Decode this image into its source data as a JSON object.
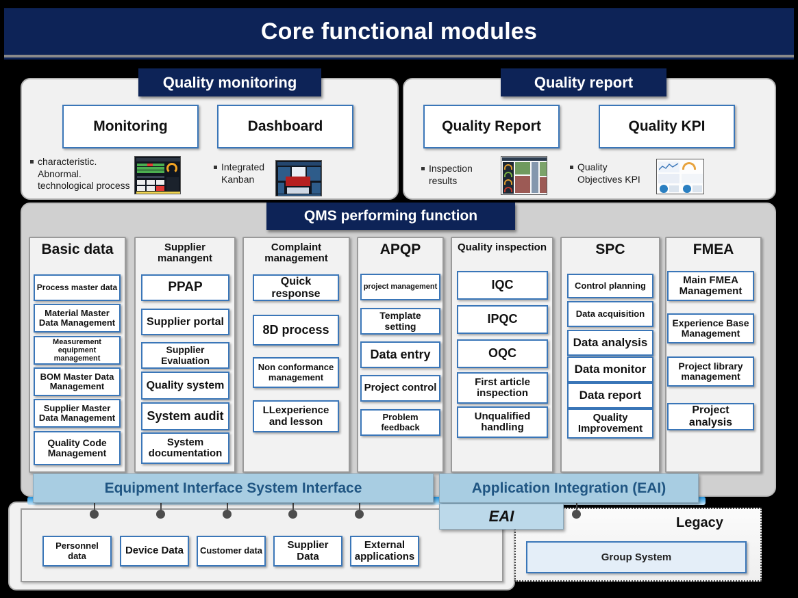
{
  "header": {
    "title": "Core functional modules"
  },
  "top_sections": [
    {
      "ribbon": "Quality monitoring",
      "boxes": [
        "Monitoring",
        "Dashboard"
      ],
      "bullets": [
        "characteristic.\nAbnormal.\ntechnological process",
        "Integrated\nKanban"
      ],
      "bullet_lines": [
        [
          "characteristic.",
          "Abnormal.",
          "technological process"
        ],
        [
          "Integrated",
          "Kanban"
        ]
      ],
      "thumbnails": [
        "monitoring-screenshot-thumbnail",
        "kanban-screenshot-thumbnail"
      ]
    },
    {
      "ribbon": "Quality report",
      "boxes": [
        "Quality Report",
        "Quality KPI"
      ],
      "bullet_lines": [
        [
          "Inspection",
          "results"
        ],
        [
          "Quality",
          "Objectives KPI"
        ]
      ],
      "thumbnails": [
        "inspection-results-thumbnail",
        "kpi-dashboard-thumbnail"
      ]
    }
  ],
  "qms": {
    "ribbon": "QMS performing function",
    "columns": [
      {
        "title": "Basic data",
        "title_size": 21,
        "items": [
          {
            "label": "Process master data",
            "size": 12
          },
          {
            "label": "Material Master Data Management",
            "size": 13
          },
          {
            "label": "Measurement equipment management",
            "size": 11
          },
          {
            "label": "BOM Master Data Management",
            "size": 13
          },
          {
            "label": "Supplier Master Data Management",
            "size": 13
          },
          {
            "label": "Quality Code Management",
            "size": 14
          }
        ]
      },
      {
        "title": "Supplier manangent",
        "title_size": 15,
        "items": [
          {
            "label": "PPAP",
            "size": 19
          },
          {
            "label": "Supplier portal",
            "size": 16
          },
          {
            "label": "Supplier Evaluation",
            "size": 14
          },
          {
            "label": "Quality system",
            "size": 16
          },
          {
            "label": "System audit",
            "size": 18
          },
          {
            "label": "System documentation",
            "size": 15
          }
        ]
      },
      {
        "title": "Complaint management",
        "title_size": 15,
        "items": [
          {
            "label": "Quick response",
            "size": 16
          },
          {
            "label": "8D process",
            "size": 18
          },
          {
            "label": "Non conformance management",
            "size": 13
          },
          {
            "label": "LLexperience and lesson",
            "size": 15
          }
        ]
      },
      {
        "title": "APQP",
        "title_size": 21,
        "items": [
          {
            "label": "project management",
            "size": 11
          },
          {
            "label": "Template setting",
            "size": 14
          },
          {
            "label": "Data entry",
            "size": 18
          },
          {
            "label": "Project control",
            "size": 15
          },
          {
            "label": "Problem feedback",
            "size": 13
          }
        ]
      },
      {
        "title": "Quality inspection",
        "title_size": 15,
        "items": [
          {
            "label": "IQC",
            "size": 18
          },
          {
            "label": "IPQC",
            "size": 18
          },
          {
            "label": "OQC",
            "size": 18
          },
          {
            "label": "First article inspection",
            "size": 15
          },
          {
            "label": "Unqualified handling",
            "size": 15
          }
        ]
      },
      {
        "title": "SPC",
        "title_size": 21,
        "items": [
          {
            "label": "Control planning",
            "size": 13
          },
          {
            "label": "Data acquisition",
            "size": 13
          },
          {
            "label": "Data analysis",
            "size": 17
          },
          {
            "label": "Data monitor",
            "size": 17
          },
          {
            "label": "Data report",
            "size": 17
          },
          {
            "label": "Quality Improvement",
            "size": 15
          }
        ]
      },
      {
        "title": "FMEA",
        "title_size": 21,
        "items": [
          {
            "label": "Main FMEA Management",
            "size": 15
          },
          {
            "label": "Experience Base Management",
            "size": 14
          },
          {
            "label": "Project library management",
            "size": 14
          },
          {
            "label": "Project analysis",
            "size": 16
          }
        ]
      }
    ]
  },
  "interfaces": {
    "equipment_bar": "Equipment Interface System Interface",
    "application_bar": "Application Integration  (EAI)",
    "eai_tag": "EAI"
  },
  "bottom": {
    "data_sources": [
      "Personnel data",
      "Device Data",
      "Customer data",
      "Supplier Data",
      "External applications"
    ],
    "legacy_title": "Legacy",
    "legacy_items": [
      "Group System"
    ]
  },
  "colors": {
    "navy": "#0d2357",
    "box_blue_border": "#3a76b8",
    "interface_blue": "#a8cde2",
    "interface_text": "#1f5582",
    "panel_grey": "#f1f1f1",
    "qms_grey": "#d0d0d0"
  }
}
